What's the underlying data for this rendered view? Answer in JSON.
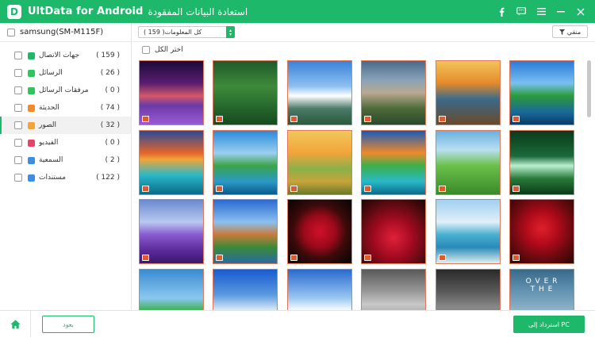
{
  "titlebar": {
    "app_name": "UltData for Android",
    "subtitle": "استعادة البيانات المفقودة",
    "logo_letter": "D",
    "icons": [
      "facebook-icon",
      "feedback-icon",
      "menu-icon",
      "minimize-icon",
      "close-icon"
    ]
  },
  "sidebar": {
    "device": "samsung(SM-M115F)",
    "items": [
      {
        "label": "جهات الاتصال",
        "count": "( 159 )",
        "icon_color": "#1db86a"
      },
      {
        "label": "الرسائل",
        "count": "( 26 )",
        "icon_color": "#2fc45c"
      },
      {
        "label": "مرفقات الرسائل",
        "count": "( 0 )",
        "icon_color": "#2fc45c"
      },
      {
        "label": "الحديثة",
        "count": "( 74 )",
        "icon_color": "#f08a2c"
      },
      {
        "label": "الصور",
        "count": "( 32 )",
        "icon_color": "#f0a43a"
      },
      {
        "label": "الفيديو",
        "count": "( 0 )",
        "icon_color": "#e6436a"
      },
      {
        "label": "السمعية",
        "count": "( 2 )",
        "icon_color": "#3a8ee6"
      },
      {
        "label": "مستندات",
        "count": "( 122 )",
        "icon_color": "#3a8ee6"
      }
    ],
    "active_index": 4
  },
  "toolbar": {
    "dropdown_value": "كل المعلومات( 159 )",
    "filter_label": "منقي"
  },
  "select_all_label": "اختر الكل",
  "photos": [
    {
      "name": "lavender-sunset-photo"
    },
    {
      "name": "forest-photo"
    },
    {
      "name": "mountains-blue-sky-photo"
    },
    {
      "name": "mountain-lake-photo"
    },
    {
      "name": "tree-sunset-photo"
    },
    {
      "name": "palm-island-photo"
    },
    {
      "name": "tropical-sunset-photo"
    },
    {
      "name": "palm-island-blue-photo"
    },
    {
      "name": "golden-lake-photo"
    },
    {
      "name": "palm-island-orange-photo"
    },
    {
      "name": "green-field-road-photo"
    },
    {
      "name": "green-waterfall-photo"
    },
    {
      "name": "lavender-field-photo"
    },
    {
      "name": "cottage-lake-photo"
    },
    {
      "name": "red-rose-photo"
    },
    {
      "name": "red-roses-photo"
    },
    {
      "name": "beach-photo"
    },
    {
      "name": "red-rose-dew-photo"
    },
    {
      "name": "beach-palm-photo"
    },
    {
      "name": "blue-sky-clouds-photo"
    },
    {
      "name": "ocean-clouds-photo"
    },
    {
      "name": "gray-texture-photo"
    },
    {
      "name": "phone-screenshot-photo"
    },
    {
      "name": "over-the-text-photo"
    }
  ],
  "last_row_text": "O V E R\nT H E",
  "footer": {
    "back_label": "بعود",
    "recover_label": "استرداد إلى PC"
  },
  "colors": {
    "accent": "#1db86a",
    "thumb_border": "#e07a5a"
  }
}
